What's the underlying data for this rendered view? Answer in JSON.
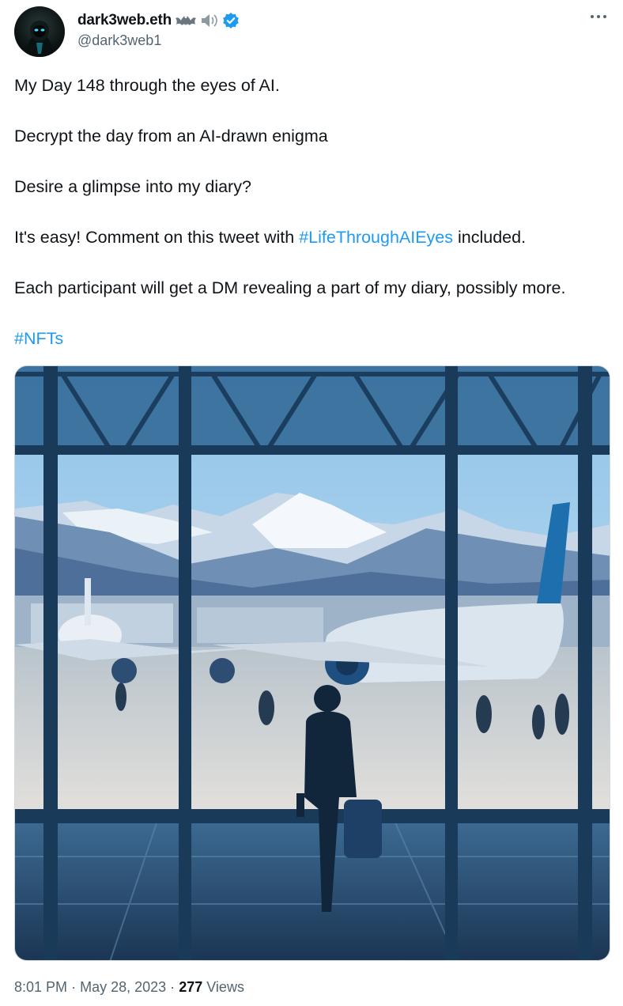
{
  "author": {
    "display_name": "dark3web.eth",
    "handle": "@dark3web1",
    "emoji_icons": [
      "bat-emoji-icon",
      "speaker-emoji-icon"
    ],
    "verified": true
  },
  "tweet": {
    "paragraphs": [
      {
        "text": "My Day 148 through the eyes of AI."
      },
      {
        "text": "Decrypt the day from an AI-drawn enigma"
      },
      {
        "text": "Desire a glimpse into my diary?"
      },
      {
        "before": "It's easy! Comment on this tweet with ",
        "hashtag": "#LifeThroughAIEyes",
        "after": " included."
      },
      {
        "text": "Each participant will get a DM revealing a part of my diary, possibly more."
      },
      {
        "hashtag": "#NFTs"
      }
    ]
  },
  "media": {
    "description_icon": "airport-illustration-image"
  },
  "meta": {
    "time": "8:01 PM",
    "separator": "·",
    "date": "May 28, 2023",
    "views_count": "277",
    "views_label": "Views"
  },
  "colors": {
    "link": "#1d9bf0",
    "secondary_text": "#536471",
    "verified": "#1d9bf0"
  }
}
